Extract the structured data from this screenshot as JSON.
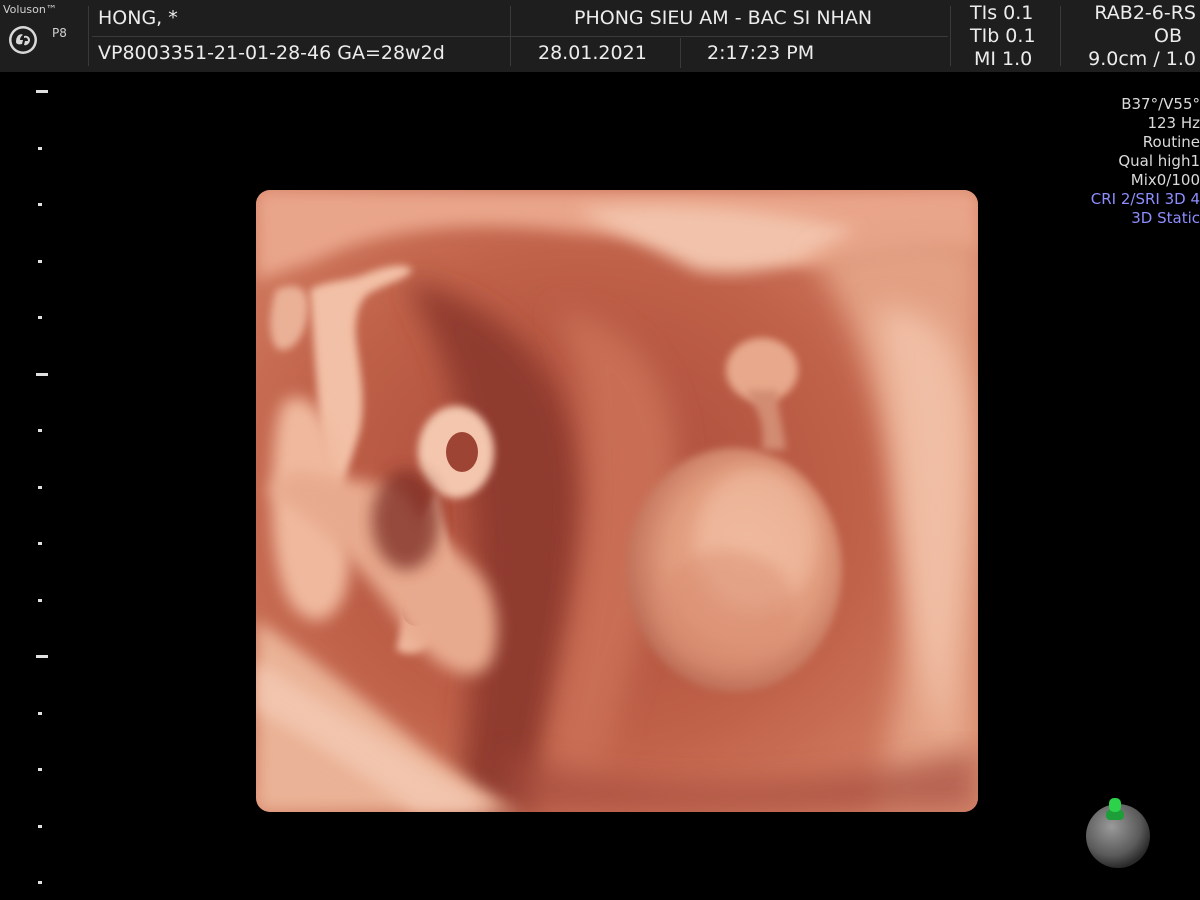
{
  "header": {
    "brand": "Voluson™",
    "model": "P8",
    "patient_name": "HONG,  *",
    "patient_id_ga": "VP8003351-21-01-28-46  GA=28w2d",
    "institution": "PHONG SIEU AM - BAC SI NHAN",
    "date": "28.01.2021",
    "time": "2:17:23 PM",
    "tis": "TIs  0.1",
    "tib": "TIb  0.1",
    "mi": "MI  1.0",
    "probe": "RAB2-6-RS",
    "application": "OB",
    "depth_zoom": "9.0cm / 1.0"
  },
  "params": {
    "angles": "B37°/V55°",
    "frequency": "123 Hz",
    "mode": "Routine",
    "quality": "Qual high1",
    "mix": "Mix0/100",
    "cri_sri": "CRI 2/SRI 3D 4",
    "render_mode": "3D Static"
  },
  "colors": {
    "background": "#000000",
    "header_bg": "#1e1e1e",
    "header_text": "#ececec",
    "param_blue": "#8d8dff",
    "orientation_green": "#2bd24a",
    "render_tone": "#c86a50"
  },
  "icons": {
    "logo": "ge-logo-icon",
    "orientation": "orientation-marker-icon"
  }
}
